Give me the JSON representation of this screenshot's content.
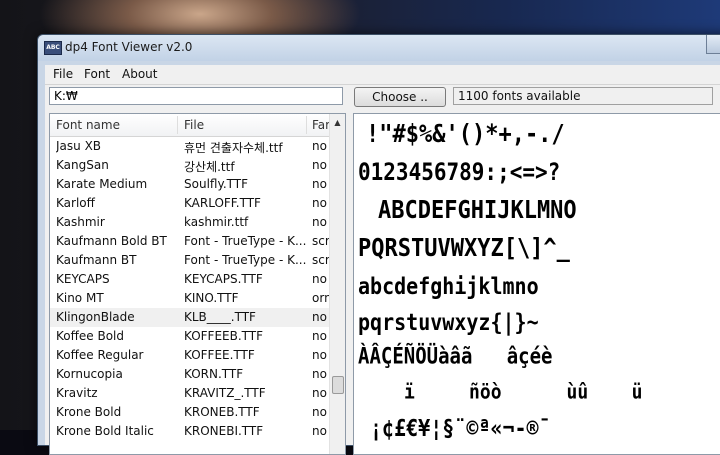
{
  "window": {
    "title": "dp4 Font Viewer v2.0",
    "icon_text": "ABC"
  },
  "menu": {
    "file": "File",
    "font": "Font",
    "about": "About"
  },
  "toolbar": {
    "path_value": "K:₩",
    "choose_label": "Choose ..",
    "status_text": "1100 fonts available"
  },
  "list": {
    "columns": [
      "Font name",
      "File",
      "Far"
    ],
    "rows": [
      {
        "name": "Jasu XB",
        "file": "휴먼 견출자수체.ttf",
        "fam": "no"
      },
      {
        "name": "KangSan",
        "file": "강산체.ttf",
        "fam": "no"
      },
      {
        "name": "Karate Medium",
        "file": "Soulfly.TTF",
        "fam": "no"
      },
      {
        "name": "Karloff",
        "file": "KARLOFF.TTF",
        "fam": "no"
      },
      {
        "name": "Kashmir",
        "file": "kashmir.ttf",
        "fam": "no"
      },
      {
        "name": "Kaufmann Bold BT",
        "file": "Font - TrueType - K...",
        "fam": "scri"
      },
      {
        "name": "Kaufmann BT",
        "file": "Font - TrueType - K...",
        "fam": "scri"
      },
      {
        "name": "KEYCAPS",
        "file": "KEYCAPS.TTF",
        "fam": "no"
      },
      {
        "name": "Kino MT",
        "file": "KINO.TTF",
        "fam": "orn"
      },
      {
        "name": "KlingonBlade",
        "file": "KLB____.TTF",
        "fam": "no"
      },
      {
        "name": "Koffee Bold",
        "file": "KOFFEEB.TTF",
        "fam": "no"
      },
      {
        "name": "Koffee Regular",
        "file": "KOFFEE.TTF",
        "fam": "no"
      },
      {
        "name": "Kornucopia",
        "file": "KORN.TTF",
        "fam": "no"
      },
      {
        "name": "Kravitz",
        "file": "KRAVITZ_.TTF",
        "fam": "no"
      },
      {
        "name": "Krone Bold",
        "file": "KRONEB.TTF",
        "fam": "no"
      },
      {
        "name": "Krone Bold Italic",
        "file": "KRONEBI.TTF",
        "fam": "no"
      }
    ],
    "selected_index": 9
  },
  "preview": {
    "lines": [
      "!\"#$%&'()*+,-./",
      "0123456789:;<=>?",
      "ABCDEFGHIJKLMNO",
      "PQRSTUVWXYZ[\\]^_",
      "abcdefghijklmno",
      "pqrstuvwxyz{|}~",
      "ÀÂÇÉÑÖÜàâã   âçéè",
      "ï     ñöò      ùû    ü",
      "¡¢£€¥¦§¨©ª«¬-®¯"
    ]
  }
}
